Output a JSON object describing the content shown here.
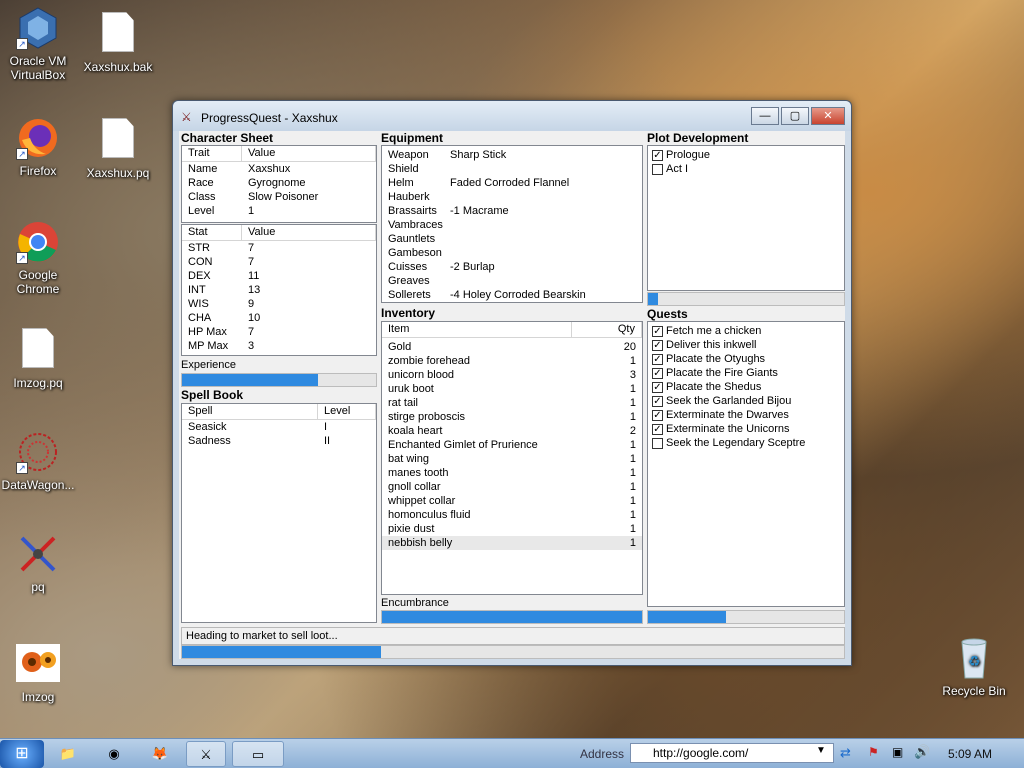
{
  "desktop": {
    "icons": [
      {
        "label": "Oracle VM\nVirtualBox",
        "line1": "Oracle VM",
        "line2": "VirtualBox"
      },
      {
        "label": "Xaxshux.bak"
      },
      {
        "label": "Firefox"
      },
      {
        "label": "Xaxshux.pq"
      },
      {
        "label": "Google",
        "line2": "Chrome"
      },
      {
        "label": "Imzog.pq"
      },
      {
        "label": "DataWagon..."
      },
      {
        "label": "pq"
      },
      {
        "label": "Imzog"
      },
      {
        "label": "Recycle Bin"
      }
    ]
  },
  "window": {
    "title": "ProgressQuest - Xaxshux",
    "buttons": {
      "minimize": "—",
      "maximize": "▢",
      "close": "✕"
    }
  },
  "character_sheet": {
    "title": "Character Sheet",
    "trait_header": [
      "Trait",
      "Value"
    ],
    "traits": [
      [
        "Name",
        "Xaxshux"
      ],
      [
        "Race",
        "Gyrognome"
      ],
      [
        "Class",
        "Slow Poisoner"
      ],
      [
        "Level",
        "1"
      ]
    ],
    "stat_header": [
      "Stat",
      "Value"
    ],
    "stats": [
      [
        "STR",
        "7"
      ],
      [
        "CON",
        "7"
      ],
      [
        "DEX",
        "11"
      ],
      [
        "INT",
        "13"
      ],
      [
        "WIS",
        "9"
      ],
      [
        "CHA",
        "10"
      ],
      [
        "HP Max",
        "7"
      ],
      [
        "MP Max",
        "3"
      ]
    ],
    "experience_label": "Experience",
    "experience_progress": 0.7
  },
  "spell_book": {
    "title": "Spell Book",
    "header": [
      "Spell",
      "Level"
    ],
    "spells": [
      [
        "Seasick",
        "I"
      ],
      [
        "Sadness",
        "II"
      ]
    ]
  },
  "equipment": {
    "title": "Equipment",
    "items": [
      [
        "Weapon",
        "Sharp Stick"
      ],
      [
        "Shield",
        ""
      ],
      [
        "Helm",
        "Faded Corroded Flannel"
      ],
      [
        "Hauberk",
        ""
      ],
      [
        "Brassairts",
        "-1 Macrame"
      ],
      [
        "Vambraces",
        ""
      ],
      [
        "Gauntlets",
        ""
      ],
      [
        "Gambeson",
        ""
      ],
      [
        "Cuisses",
        "-2 Burlap"
      ],
      [
        "Greaves",
        ""
      ],
      [
        "Sollerets",
        "-4 Holey Corroded Bearskin"
      ]
    ]
  },
  "inventory": {
    "title": "Inventory",
    "header": [
      "Item",
      "Qty"
    ],
    "items": [
      [
        "Gold",
        "20"
      ],
      [
        "zombie forehead",
        "1"
      ],
      [
        "unicorn blood",
        "3"
      ],
      [
        "uruk boot",
        "1"
      ],
      [
        "rat tail",
        "1"
      ],
      [
        "stirge proboscis",
        "1"
      ],
      [
        "koala heart",
        "2"
      ],
      [
        "Enchanted Gimlet of Prurience",
        "1"
      ],
      [
        "bat wing",
        "1"
      ],
      [
        "manes tooth",
        "1"
      ],
      [
        "gnoll collar",
        "1"
      ],
      [
        "whippet collar",
        "1"
      ],
      [
        "homonculus fluid",
        "1"
      ],
      [
        "pixie dust",
        "1"
      ],
      [
        "nebbish belly",
        "1"
      ]
    ],
    "encumbrance_label": "Encumbrance",
    "encumbrance_progress": 1.0
  },
  "plot": {
    "title": "Plot Development",
    "acts": [
      {
        "label": "Prologue",
        "checked": true
      },
      {
        "label": "Act I",
        "checked": false
      }
    ],
    "progress": 0.05
  },
  "quests": {
    "title": "Quests",
    "items": [
      {
        "label": "Fetch me a chicken",
        "checked": true
      },
      {
        "label": "Deliver this inkwell",
        "checked": true
      },
      {
        "label": "Placate the Otyughs",
        "checked": true
      },
      {
        "label": "Placate the Fire Giants",
        "checked": true
      },
      {
        "label": "Placate the Shedus",
        "checked": true
      },
      {
        "label": "Seek the Garlanded Bijou",
        "checked": true
      },
      {
        "label": "Exterminate the Dwarves",
        "checked": true
      },
      {
        "label": "Exterminate the Unicorns",
        "checked": true
      },
      {
        "label": "Seek the Legendary Sceptre",
        "checked": false
      }
    ],
    "progress": 0.4
  },
  "status": {
    "text": "Heading to market to sell loot...",
    "progress": 0.3
  },
  "taskbar": {
    "address_label": "Address",
    "address_value": "http://google.com/",
    "clock": "5:09 AM"
  }
}
